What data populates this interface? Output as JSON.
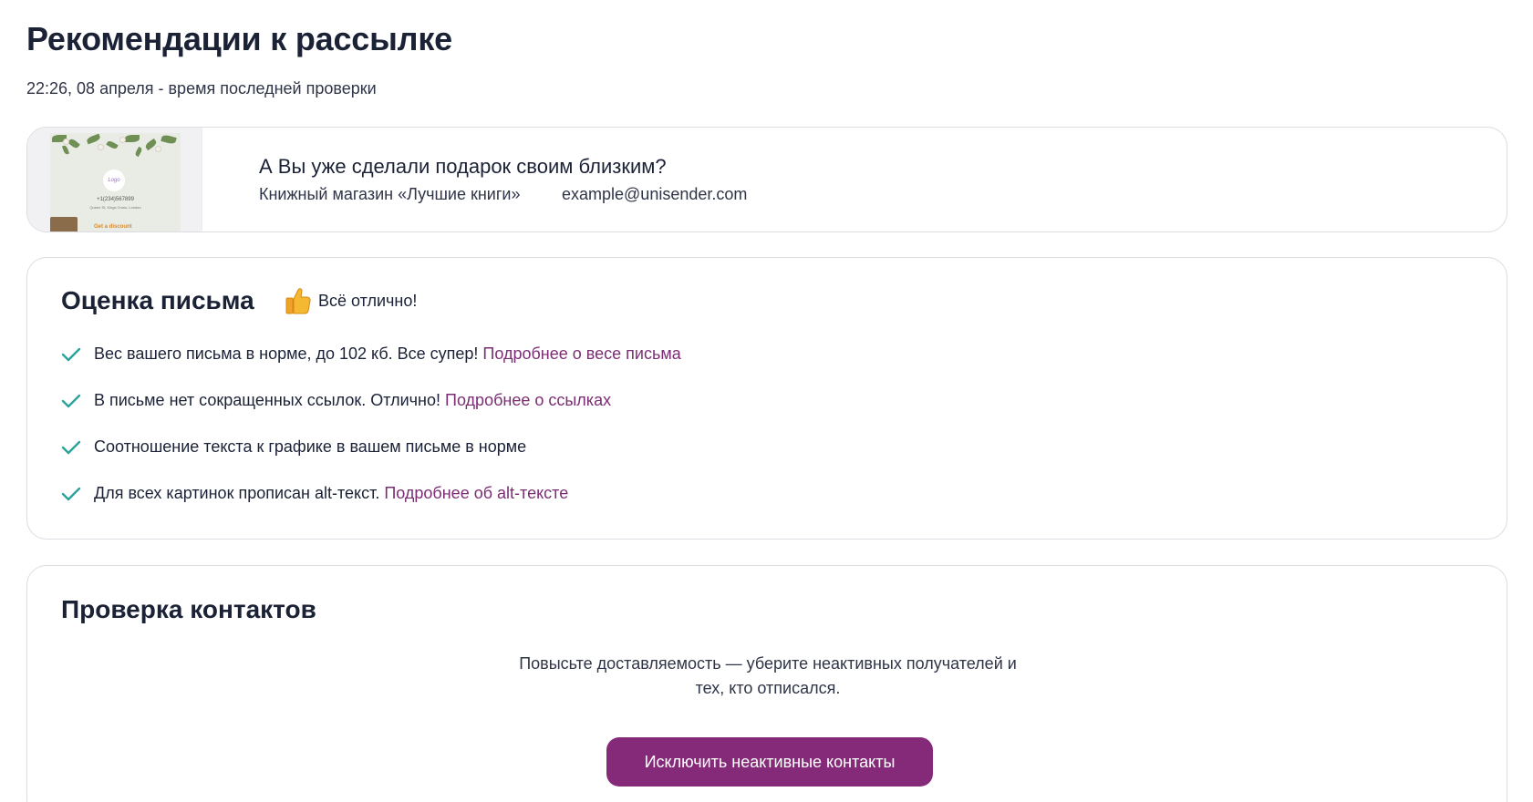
{
  "header": {
    "title": "Рекомендации к рассылке",
    "check_time": "22:26, 08 апреля - время последней проверки"
  },
  "email_preview": {
    "subject": "А Вы уже сделали подарок своим близким?",
    "sender": "Книжный магазин «Лучшие книги»",
    "address": "example@unisender.com",
    "thumbnail": {
      "logo": "Logo",
      "phone": "+1(234)567899",
      "address": "Queen St, Kings Cross, London",
      "cta": "Get a discount"
    }
  },
  "evaluation": {
    "title": "Оценка письма",
    "status": "Всё отлично!",
    "status_icon": "thumbs-up-icon",
    "items": [
      {
        "text": "Вес вашего письма в норме, до 102 кб. Все супер!",
        "link": "Подробнее о весе письма"
      },
      {
        "text": "В письме нет сокращенных ссылок. Отлично!",
        "link": "Подробнее о ссылках"
      },
      {
        "text": "Соотношение текста к графике в вашем письме в норме",
        "link": ""
      },
      {
        "text": "Для всех картинок прописан alt-текст.",
        "link": "Подробнее об alt-тексте"
      }
    ]
  },
  "contacts": {
    "title": "Проверка контактов",
    "description_line1": "Повысьте доставляемость — уберите неактивных получателей и",
    "description_line2": "тех, кто отписался.",
    "button_label": "Исключить неактивные контакты"
  },
  "colors": {
    "accent": "#842a78",
    "link": "#7b2d74",
    "check": "#2aa39a",
    "text": "#1b2236",
    "border": "#dcdde3"
  }
}
